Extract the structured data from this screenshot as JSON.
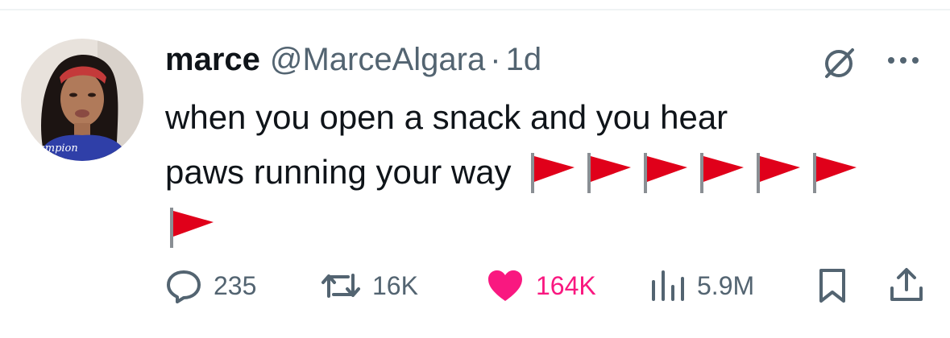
{
  "author": {
    "name": "marce",
    "handle": "@MarceAlgara",
    "separator": "·",
    "time": "1d",
    "avatar_shirt_text": "ampion"
  },
  "tweet": {
    "line1": "when you open a snack and you hear",
    "line2": "paws running your way"
  },
  "icons": {
    "grok": "grok-icon",
    "more": "more-icon",
    "flag": "triangular-red-flag-emoji"
  },
  "stats": {
    "replies": "235",
    "retweets": "16K",
    "likes": "164K",
    "views": "5.9M"
  },
  "colors": {
    "text": "#0f1419",
    "secondary": "#536471",
    "like": "#f91880",
    "flag": "#e0001a"
  }
}
